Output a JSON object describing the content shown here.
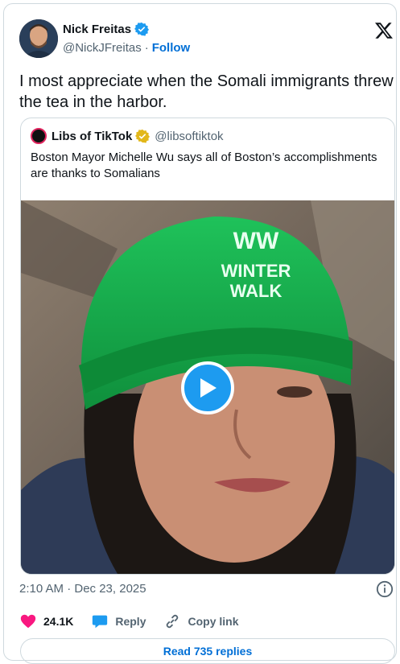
{
  "tweet": {
    "author_name": "Nick Freitas",
    "author_handle": "@NickJFreitas",
    "separator": "·",
    "follow_label": "Follow",
    "text": "I most appreciate when the Somali immigrants threw the tea in the harbor.",
    "timestamp": "2:10 AM · Dec 23, 2025"
  },
  "quote": {
    "author_name": "Libs of TikTok",
    "author_handle": "@libsoftiktok",
    "text": "Boston Mayor Michelle Wu says all of Boston’s accomplishments are thanks to Somalians",
    "hat_line1": "WINTER",
    "hat_line2": "WALK"
  },
  "actions": {
    "likes": "24.1K",
    "reply_label": "Reply",
    "copy_link_label": "Copy link",
    "read_replies_label": "Read 735 replies"
  },
  "colors": {
    "accent": "#1d9bf0",
    "link": "#006fd6",
    "like": "#f91880",
    "verified_gold": "#e2b719",
    "hat_green": "#14a84a"
  },
  "icons": [
    "verified-badge-icon",
    "x-logo-icon",
    "play-icon",
    "info-icon",
    "heart-icon",
    "reply-bubble-icon",
    "link-icon"
  ]
}
